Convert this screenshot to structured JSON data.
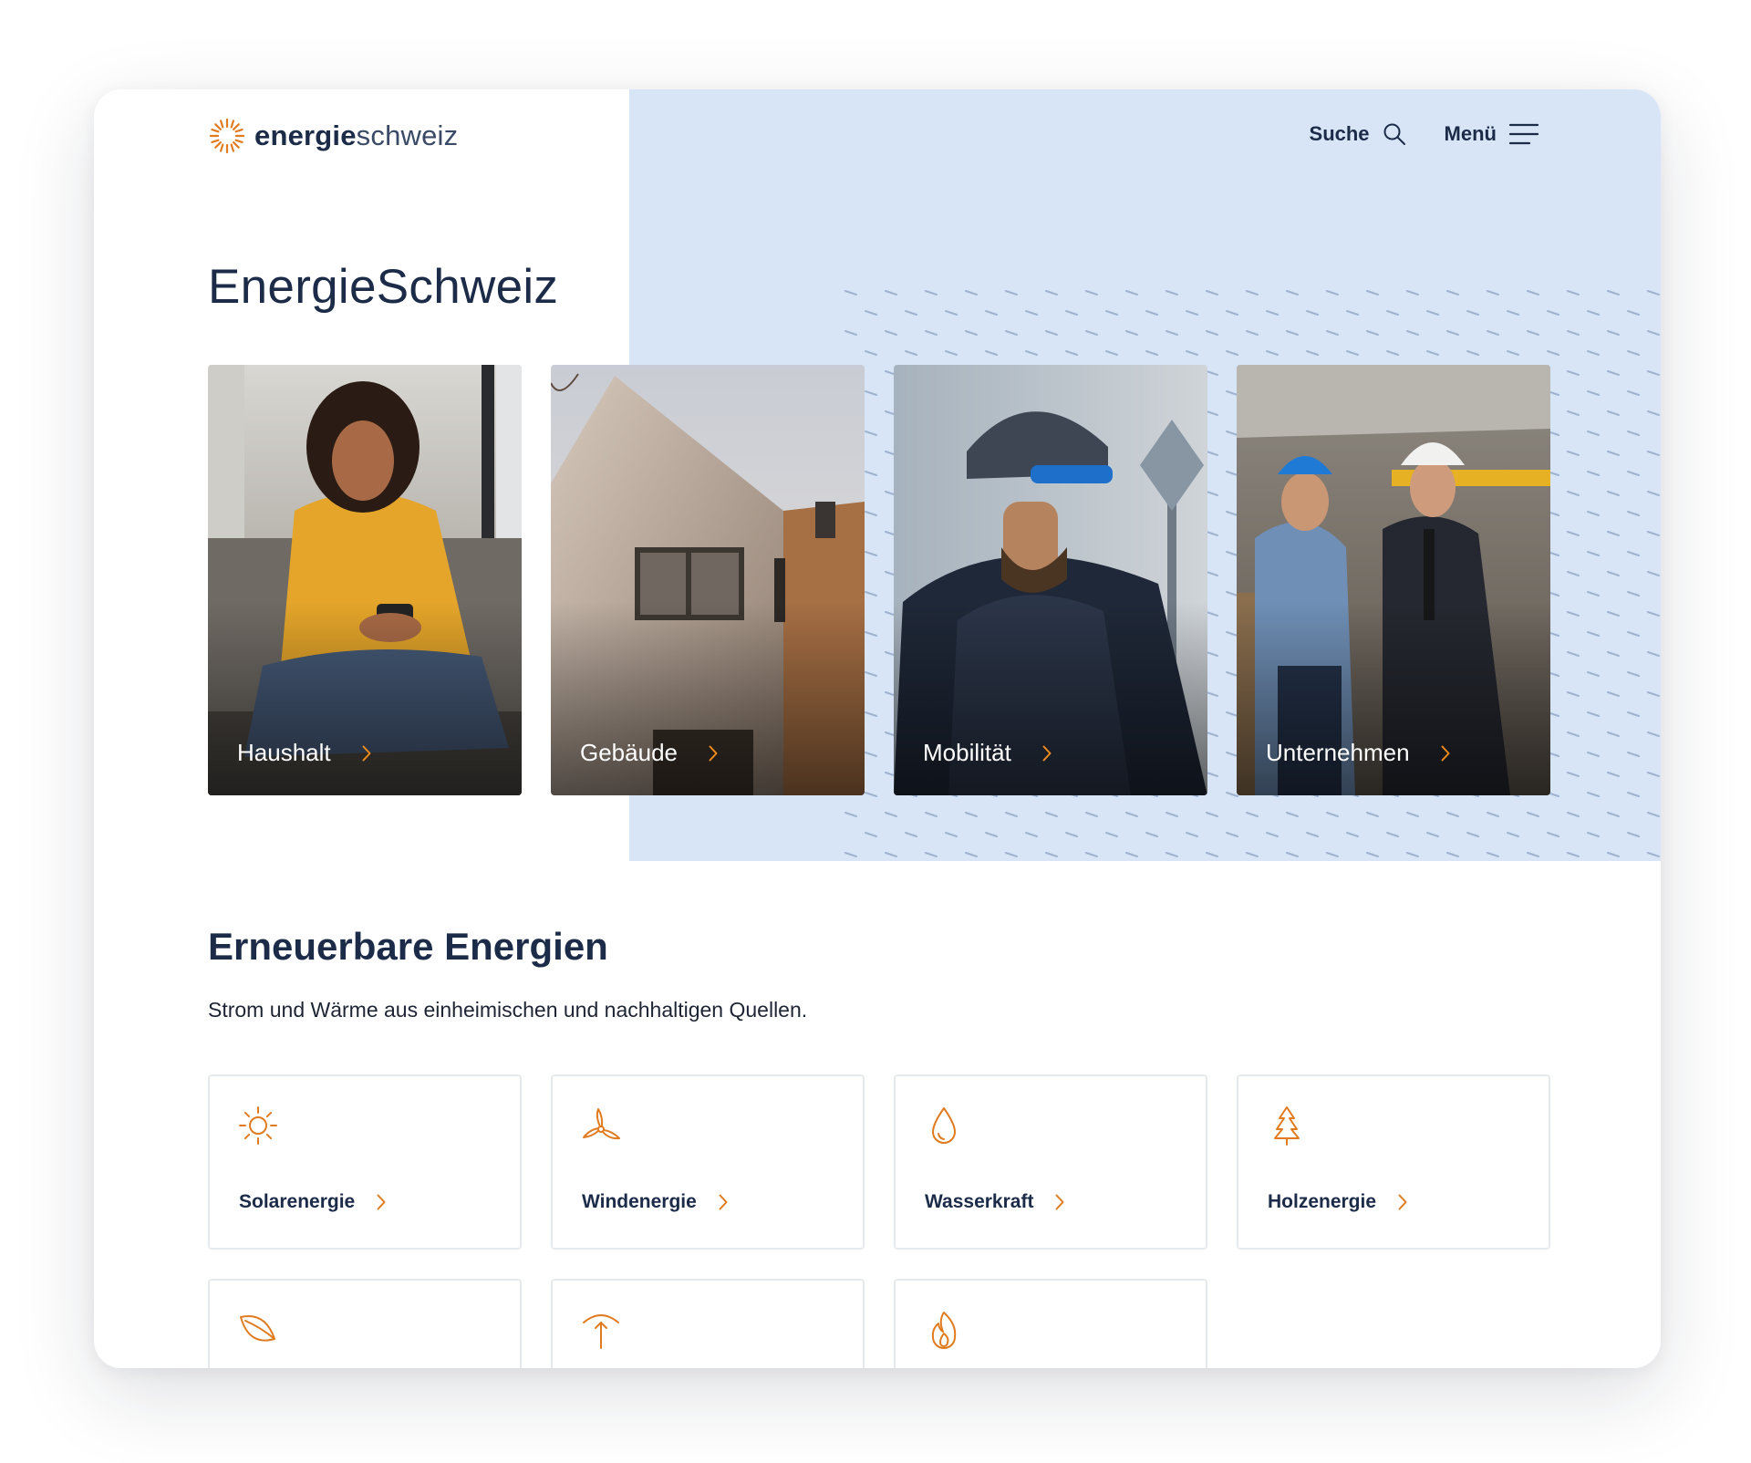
{
  "brand": {
    "name_bold": "energie",
    "name_light": "schweiz",
    "accent": "#e07b1f",
    "hero_bg": "#d8e5f6"
  },
  "header": {
    "search_label": "Suche",
    "menu_label": "Menü"
  },
  "hero": {
    "title": "EnergieSchweiz",
    "cards": [
      {
        "label": "Haushalt"
      },
      {
        "label": "Gebäude"
      },
      {
        "label": "Mobilität"
      },
      {
        "label": "Unternehmen"
      }
    ]
  },
  "renewables": {
    "title": "Erneuerbare Energien",
    "subtitle": "Strom und Wärme aus einheimischen und nachhaltigen Quellen.",
    "tiles": [
      {
        "label": "Solarenergie",
        "icon": "sun-icon"
      },
      {
        "label": "Windenergie",
        "icon": "wind-turbine-icon"
      },
      {
        "label": "Wasserkraft",
        "icon": "water-drop-icon"
      },
      {
        "label": "Holzenergie",
        "icon": "tree-icon"
      },
      {
        "label": "",
        "icon": "leaf-icon"
      },
      {
        "label": "",
        "icon": "geothermal-icon"
      },
      {
        "label": "",
        "icon": "flame-icon"
      }
    ]
  }
}
